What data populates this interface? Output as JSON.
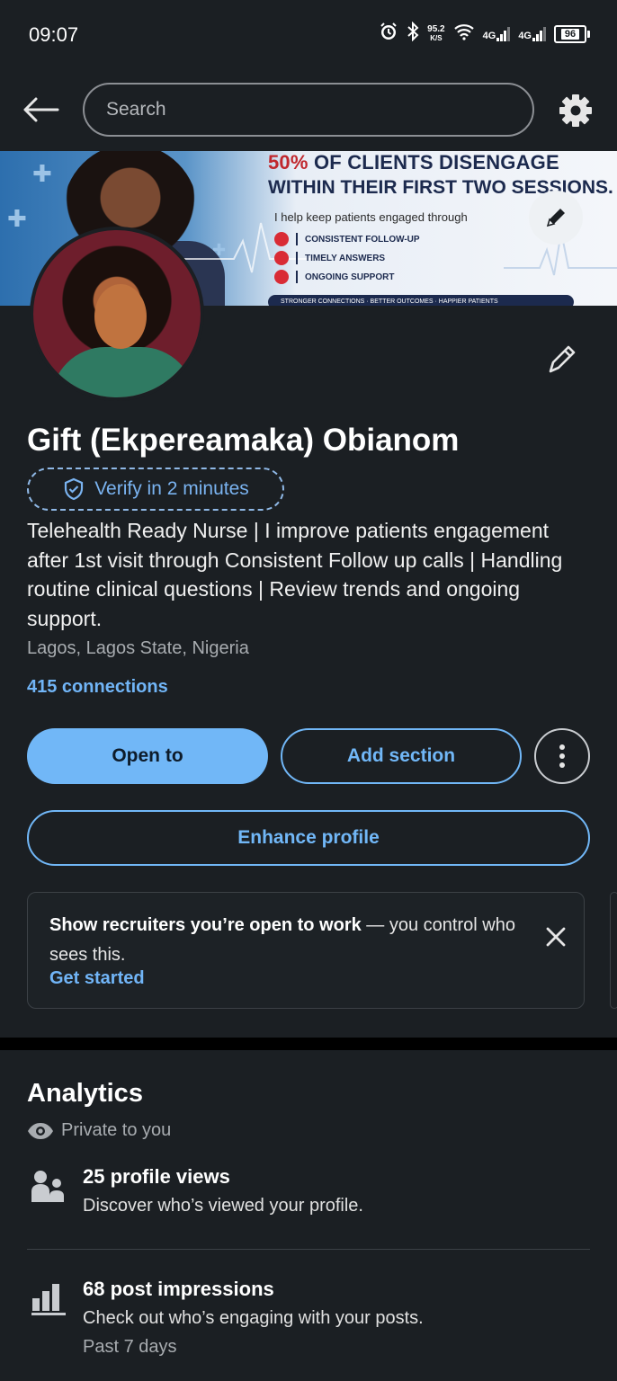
{
  "status_bar": {
    "time": "09:07",
    "speed_value": "95.2",
    "speed_unit": "K/S",
    "network1": "4G",
    "network2": "4G",
    "battery": "96"
  },
  "header": {
    "search_placeholder": "Search",
    "icons": [
      "back-arrow-icon",
      "gear-icon"
    ]
  },
  "banner": {
    "line1_red": "50%",
    "line1_rest": " OF CLIENTS DISENGAGE",
    "line2": "WITHIN THEIR FIRST TWO SESSIONS.",
    "sub": "I help keep patients engaged through",
    "items": [
      "CONSISTENT FOLLOW-UP",
      "TIMELY ANSWERS",
      "ONGOING SUPPORT"
    ],
    "footer": "STRONGER CONNECTIONS · BETTER OUTCOMES · HAPPIER PATIENTS"
  },
  "profile": {
    "name": "Gift (Ekpereamaka) Obianom",
    "verify_label": "Verify in 2 minutes",
    "headline": "Telehealth Ready Nurse | I improve patients engagement after 1st visit through Consistent Follow up calls | Handling routine clinical questions | Review trends and ongoing support.",
    "location": "Lagos, Lagos State, Nigeria",
    "connections": "415 connections"
  },
  "actions": {
    "open_to": "Open to",
    "add_section": "Add section",
    "enhance_profile": "Enhance profile"
  },
  "open_to_work_card": {
    "bold": "Show recruiters you’re open to work",
    "rest": " — you control who sees this.",
    "link": "Get started"
  },
  "analytics": {
    "title": "Analytics",
    "privacy": "Private to you",
    "items": [
      {
        "title": "25 profile views",
        "desc": "Discover who’s viewed your profile.",
        "icon": "people-icon"
      },
      {
        "title": "68 post impressions",
        "desc": "Check out who’s engaging with your posts.",
        "period": "Past 7 days",
        "icon": "bar-chart-icon"
      }
    ]
  },
  "colors": {
    "accent": "#71b7f7",
    "surface": "#1b1f23",
    "divider": "#000000"
  }
}
